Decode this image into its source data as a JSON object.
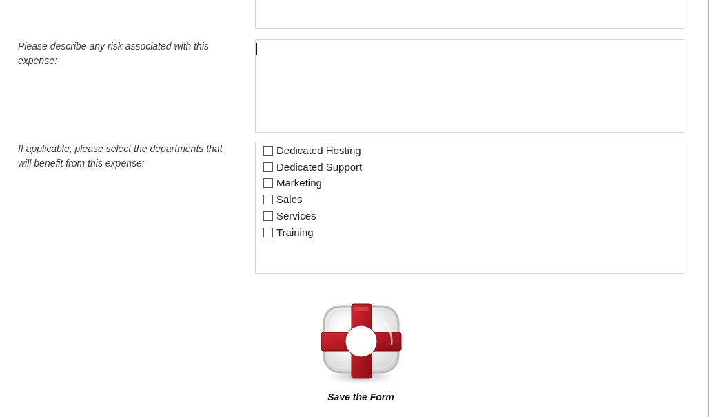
{
  "form": {
    "rows": [
      {
        "kind": "textarea",
        "focused": false
      },
      {
        "kind": "textarea",
        "label": "Please describe any risk associated with this expense:",
        "focused": true
      },
      {
        "kind": "checklist",
        "label": "If applicable, please select the departments that will benefit from this expense:",
        "options": [
          {
            "label": "Dedicated Hosting",
            "checked": false
          },
          {
            "label": "Dedicated Support",
            "checked": false
          },
          {
            "label": "Marketing",
            "checked": false
          },
          {
            "label": "Sales",
            "checked": false
          },
          {
            "label": "Services",
            "checked": false
          },
          {
            "label": "Training",
            "checked": false
          }
        ]
      }
    ]
  },
  "save_button": {
    "label": "Save the Form"
  }
}
